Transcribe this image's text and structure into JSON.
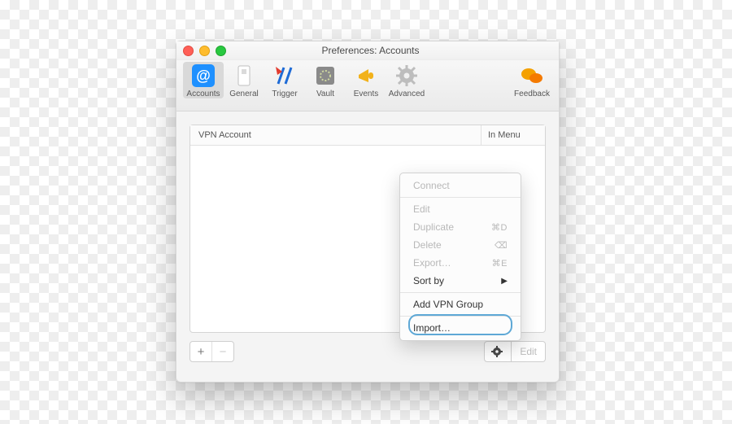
{
  "window": {
    "title": "Preferences: Accounts"
  },
  "toolbar": {
    "accounts": "Accounts",
    "general": "General",
    "trigger": "Trigger",
    "vault": "Vault",
    "events": "Events",
    "advanced": "Advanced",
    "feedback": "Feedback"
  },
  "list": {
    "col_account": "VPN Account",
    "col_menu": "In Menu"
  },
  "bottom": {
    "add": "+",
    "remove": "−",
    "edit": "Edit"
  },
  "menu": {
    "connect": "Connect",
    "edit": "Edit",
    "duplicate": "Duplicate",
    "duplicate_sc": "⌘D",
    "delete": "Delete",
    "delete_sc": "⌫",
    "export": "Export…",
    "export_sc": "⌘E",
    "sortby": "Sort by",
    "addgroup": "Add VPN Group",
    "import": "Import…"
  }
}
